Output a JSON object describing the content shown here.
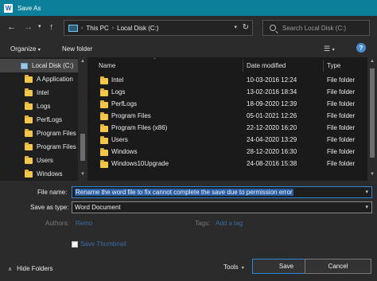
{
  "window": {
    "title": "Save As",
    "app_icon": "word-icon"
  },
  "nav": {
    "back_icon": "arrow-left-icon",
    "forward_icon": "arrow-right-icon",
    "recent_icon": "chevron-down-icon",
    "up_icon": "arrow-up-icon",
    "breadcrumbs": [
      "This PC",
      "Local Disk (C:)"
    ],
    "search_placeholder": "Search Local Disk (C:)"
  },
  "toolbar": {
    "organize": "Organize",
    "new_folder": "New folder"
  },
  "navpane": {
    "items": [
      {
        "label": "Local Disk (C:)",
        "kind": "drive",
        "selected": true
      },
      {
        "label": "A Application",
        "kind": "folder"
      },
      {
        "label": "Intel",
        "kind": "folder"
      },
      {
        "label": "Logs",
        "kind": "folder"
      },
      {
        "label": "PerfLogs",
        "kind": "folder"
      },
      {
        "label": "Program Files",
        "kind": "folder"
      },
      {
        "label": "Program Files",
        "kind": "folder"
      },
      {
        "label": "Users",
        "kind": "folder"
      },
      {
        "label": "Windows",
        "kind": "folder"
      }
    ]
  },
  "files": {
    "columns": {
      "name": "Name",
      "date": "Date modified",
      "type": "Type"
    },
    "rows": [
      {
        "name": "Intel",
        "date": "10-03-2016 12:24",
        "type": "File folder"
      },
      {
        "name": "Logs",
        "date": "13-02-2016 18:34",
        "type": "File folder"
      },
      {
        "name": "PerfLogs",
        "date": "18-09-2020 12:39",
        "type": "File folder"
      },
      {
        "name": "Program Files",
        "date": "05-01-2021 12:26",
        "type": "File folder"
      },
      {
        "name": "Program Files (x86)",
        "date": "22-12-2020 16:20",
        "type": "File folder"
      },
      {
        "name": "Users",
        "date": "24-04-2020 13:29",
        "type": "File folder"
      },
      {
        "name": "Windows",
        "date": "28-12-2020 16:30",
        "type": "File folder"
      },
      {
        "name": "Windows10Upgrade",
        "date": "24-08-2016 15:38",
        "type": "File folder"
      }
    ]
  },
  "form": {
    "file_name_label": "File name:",
    "file_name_value": "Rename the word file to fix cannot complete the save due to permission error",
    "save_type_label": "Save as type:",
    "save_type_value": "Word Document",
    "authors_label": "Authors:",
    "authors_value": "Remo",
    "tags_label": "Tags:",
    "tags_value": "Add a tag",
    "thumbnail_label": "Save Thumbnail"
  },
  "footer": {
    "hide_folders": "Hide Folders",
    "tools": "Tools",
    "save": "Save",
    "cancel": "Cancel"
  },
  "colors": {
    "titlebar": "#0c7f9b",
    "accent": "#2e86d8",
    "folder": "#f3c84a"
  }
}
